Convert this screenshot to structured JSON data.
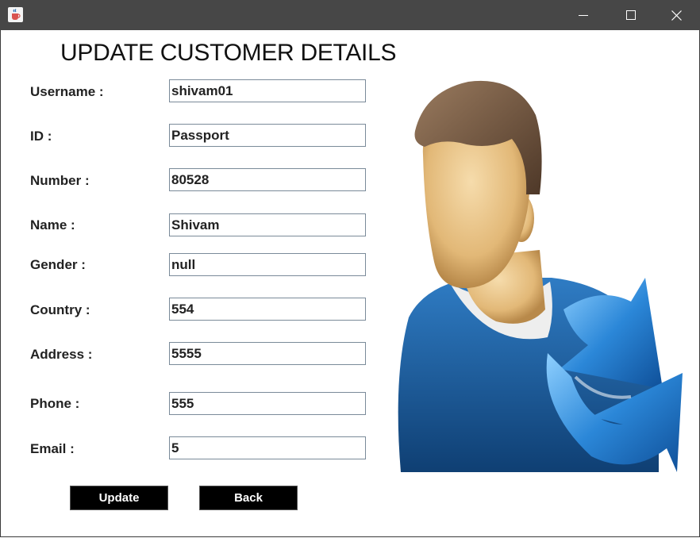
{
  "window": {
    "app_icon": "java-cup-icon",
    "controls": [
      "minimize-icon",
      "maximize-icon",
      "close-icon"
    ]
  },
  "heading": "UPDATE CUSTOMER DETAILS",
  "form": {
    "fields": [
      {
        "label": "Username :",
        "value": "shivam01"
      },
      {
        "label": "ID :",
        "value": "Passport"
      },
      {
        "label": "Number :",
        "value": "80528"
      },
      {
        "label": "Name :",
        "value": "Shivam"
      },
      {
        "label": "Gender :",
        "value": "null"
      },
      {
        "label": "Country :",
        "value": "554"
      },
      {
        "label": "Address :",
        "value": "5555"
      },
      {
        "label": "Phone :",
        "value": "555"
      },
      {
        "label": "Email :",
        "value": "5"
      }
    ]
  },
  "buttons": {
    "update": "Update",
    "back": "Back"
  },
  "illustration": {
    "icon": "user-update-icon",
    "colors": {
      "shirt": "#1f63a6",
      "arrow": "#2b87d8",
      "hair": "#6e5440",
      "skin": "#e8c58f"
    }
  }
}
